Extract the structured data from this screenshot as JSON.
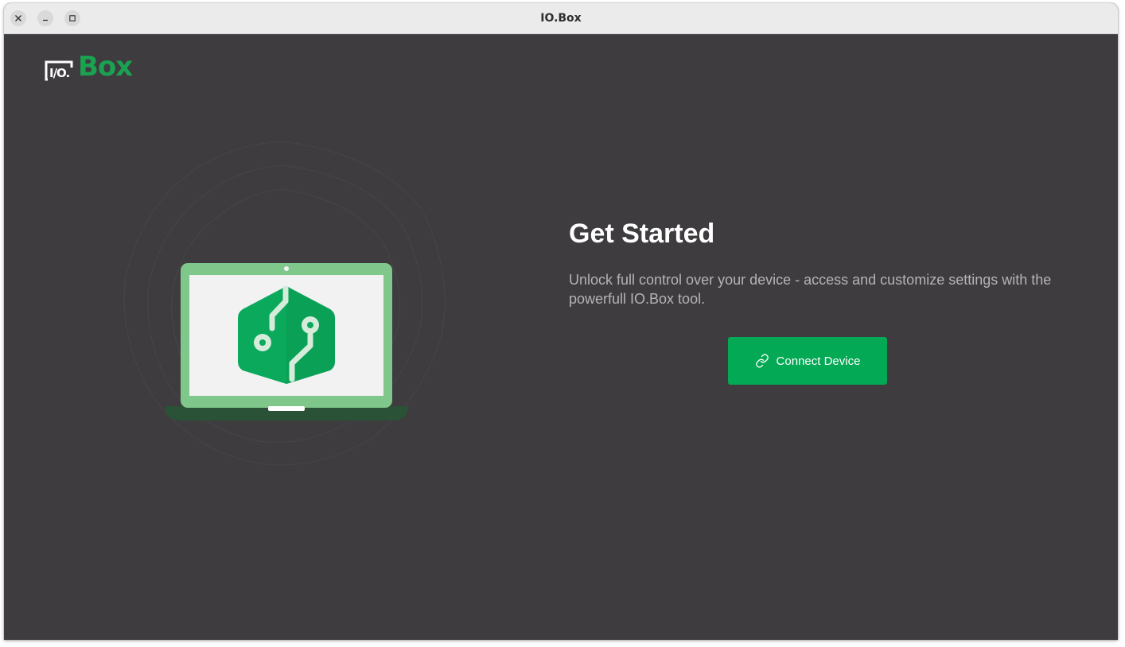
{
  "window": {
    "title": "IO.Box",
    "controls": {
      "close_icon": "close-icon",
      "minimize_icon": "minimize-icon",
      "maximize_icon": "maximize-icon"
    }
  },
  "logo": {
    "io_text": "I/O.",
    "box_text": "Box"
  },
  "illustration": {
    "icon": "laptop-circuit-icon"
  },
  "main": {
    "heading": "Get Started",
    "subtitle": "Unlock full control over your device - access and customize settings with the powerfull IO.Box tool.",
    "connect_button": {
      "label": "Connect Device",
      "icon": "link-icon"
    }
  },
  "colors": {
    "background": "#3e3c3f",
    "accent": "#03a954",
    "brand_green": "#1aa251",
    "laptop_frame": "#7fc78a"
  }
}
